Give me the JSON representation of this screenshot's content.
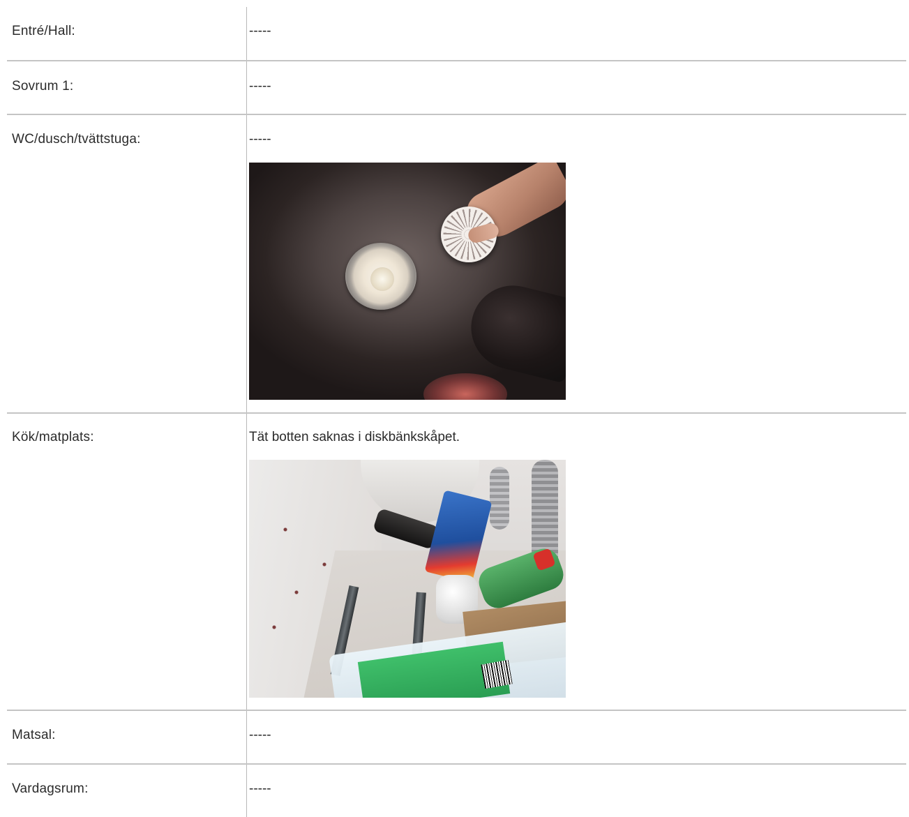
{
  "rows": [
    {
      "label": "Entré/Hall:",
      "value": "-----"
    },
    {
      "label": "Sovrum 1:",
      "value": "-----"
    },
    {
      "label": "WC/dusch/tvättstuga:",
      "value": "-----"
    },
    {
      "label": "Kök/matplats:",
      "value": "Tät botten saknas i diskbänkskåpet."
    },
    {
      "label": "Matsal:",
      "value": "-----"
    },
    {
      "label": "Vardagsrum:",
      "value": "-----"
    }
  ]
}
